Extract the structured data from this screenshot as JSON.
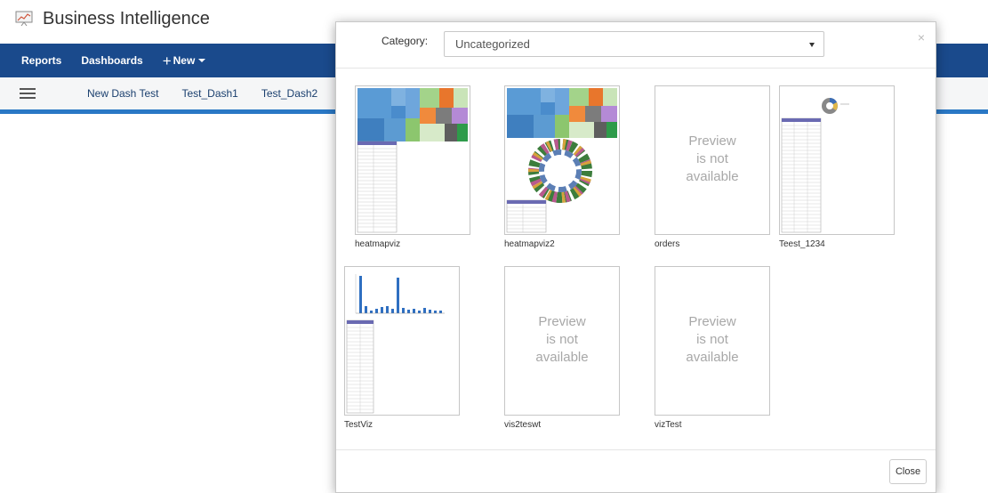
{
  "app": {
    "title": "Business Intelligence",
    "logo_icon": "presentation-chart-icon"
  },
  "nav": {
    "reports": "Reports",
    "dashboards": "Dashboards",
    "new_label": "New",
    "new_icon": "+"
  },
  "tabs": [
    "New Dash Test",
    "Test_Dash1",
    "Test_Dash2"
  ],
  "modal": {
    "category_label": "Category:",
    "category_value": "Uncategorized",
    "close_x": "×",
    "close_button": "Close",
    "items": [
      {
        "name": "heatmapviz",
        "preview": "treemap-table"
      },
      {
        "name": "heatmapviz2",
        "preview": "treemap-sunburst"
      },
      {
        "name": "orders",
        "preview": "none"
      },
      {
        "name": "Teest_1234",
        "preview": "pie-table"
      },
      {
        "name": "TestViz",
        "preview": "bar-table"
      },
      {
        "name": "vis2teswt",
        "preview": "none"
      },
      {
        "name": "vizTest",
        "preview": "none"
      }
    ],
    "no_preview_lines": [
      "Preview",
      "is not",
      "available"
    ]
  },
  "colors": {
    "nav_bg": "#1a4a8c",
    "accent": "#2a78c5",
    "text_dark": "#333333"
  }
}
